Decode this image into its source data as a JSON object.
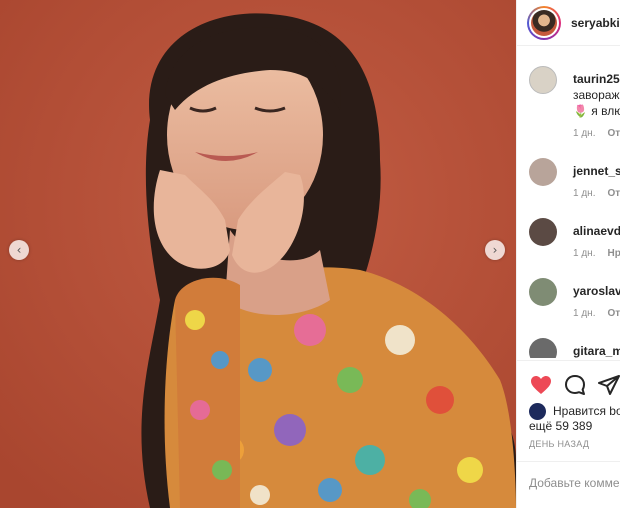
{
  "post": {
    "username": "seryabkina",
    "prev_icon": "chevron-left-icon",
    "next_icon": "chevron-right-icon",
    "prev_glyph": "‹",
    "next_glyph": "›"
  },
  "comments": [
    {
      "username": "taurin25",
      "text_lines": [
        "завораживает",
        "🌷 я влюблена"
      ],
      "time": "1 дн.",
      "reply": "Ответить",
      "avatar_color": "#d9d2c6"
    },
    {
      "username": "jennet_se",
      "text_lines": [],
      "time": "1 дн.",
      "reply": "Ответить",
      "avatar_color": "#b8a49a"
    },
    {
      "username": "alinaevdo",
      "text_lines": [],
      "time": "1 дн.",
      "reply": "Нравится",
      "avatar_color": "#5b4a44"
    },
    {
      "username": "yaroslav_",
      "text_lines": [],
      "time": "1 дн.",
      "reply": "Ответить",
      "avatar_color": "#7f8c74"
    },
    {
      "username": "gitara_m",
      "text_lines": [],
      "time": "",
      "reply": "",
      "avatar_color": "#6a6a6a"
    }
  ],
  "actions": {
    "like_icon": "heart-icon",
    "comment_icon": "comment-icon",
    "share_icon": "share-icon",
    "like_color": "#ed4956"
  },
  "likes": {
    "line1": "Нравится bo",
    "line2": "ещё 59 389"
  },
  "time_ago": "ДЕНЬ НАЗАД",
  "add_comment": {
    "placeholder": "Добавьте комментарий..."
  }
}
